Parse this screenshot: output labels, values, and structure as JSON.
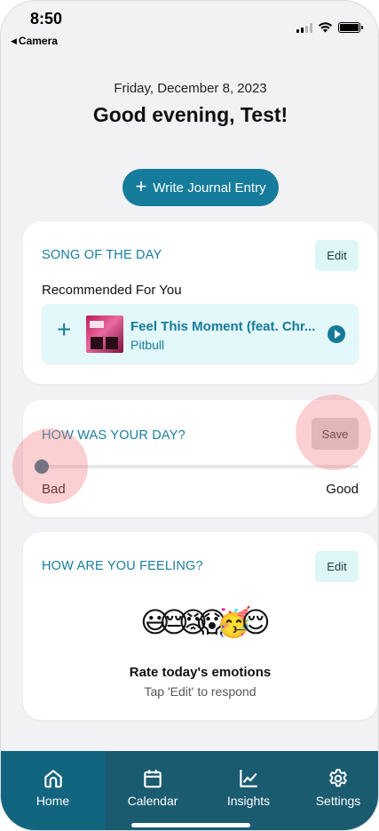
{
  "status_bar": {
    "time": "8:50",
    "back_label": "Camera"
  },
  "header": {
    "date": "Friday, December 8, 2023",
    "greeting": "Good evening, Test!"
  },
  "write_button": {
    "label": "Write Journal Entry"
  },
  "song_card": {
    "title": "SONG OF THE DAY",
    "edit_label": "Edit",
    "subtitle": "Recommended For You",
    "song": {
      "name": "Feel This Moment (feat. Chr...",
      "artist": "Pitbull"
    }
  },
  "day_card": {
    "title": "HOW WAS YOUR DAY?",
    "save_label": "Save",
    "slider": {
      "min_label": "Bad",
      "max_label": "Good",
      "value": 0
    }
  },
  "feeling_card": {
    "title": "HOW ARE YOU FEELING?",
    "edit_label": "Edit",
    "emojis": [
      "😃",
      "😔",
      "😡",
      "😱",
      "🥳",
      "😌"
    ],
    "prompt": "Rate today's emotions",
    "hint": "Tap 'Edit' to respond"
  },
  "tabs": [
    {
      "label": "Home",
      "icon": "home-icon",
      "active": true
    },
    {
      "label": "Calendar",
      "icon": "calendar-icon",
      "active": false
    },
    {
      "label": "Insights",
      "icon": "chart-line-icon",
      "active": false
    },
    {
      "label": "Settings",
      "icon": "gear-icon",
      "active": false
    }
  ],
  "colors": {
    "accent": "#167c9c",
    "tabbar": "#1a5b70",
    "chip": "#dff6f7"
  }
}
